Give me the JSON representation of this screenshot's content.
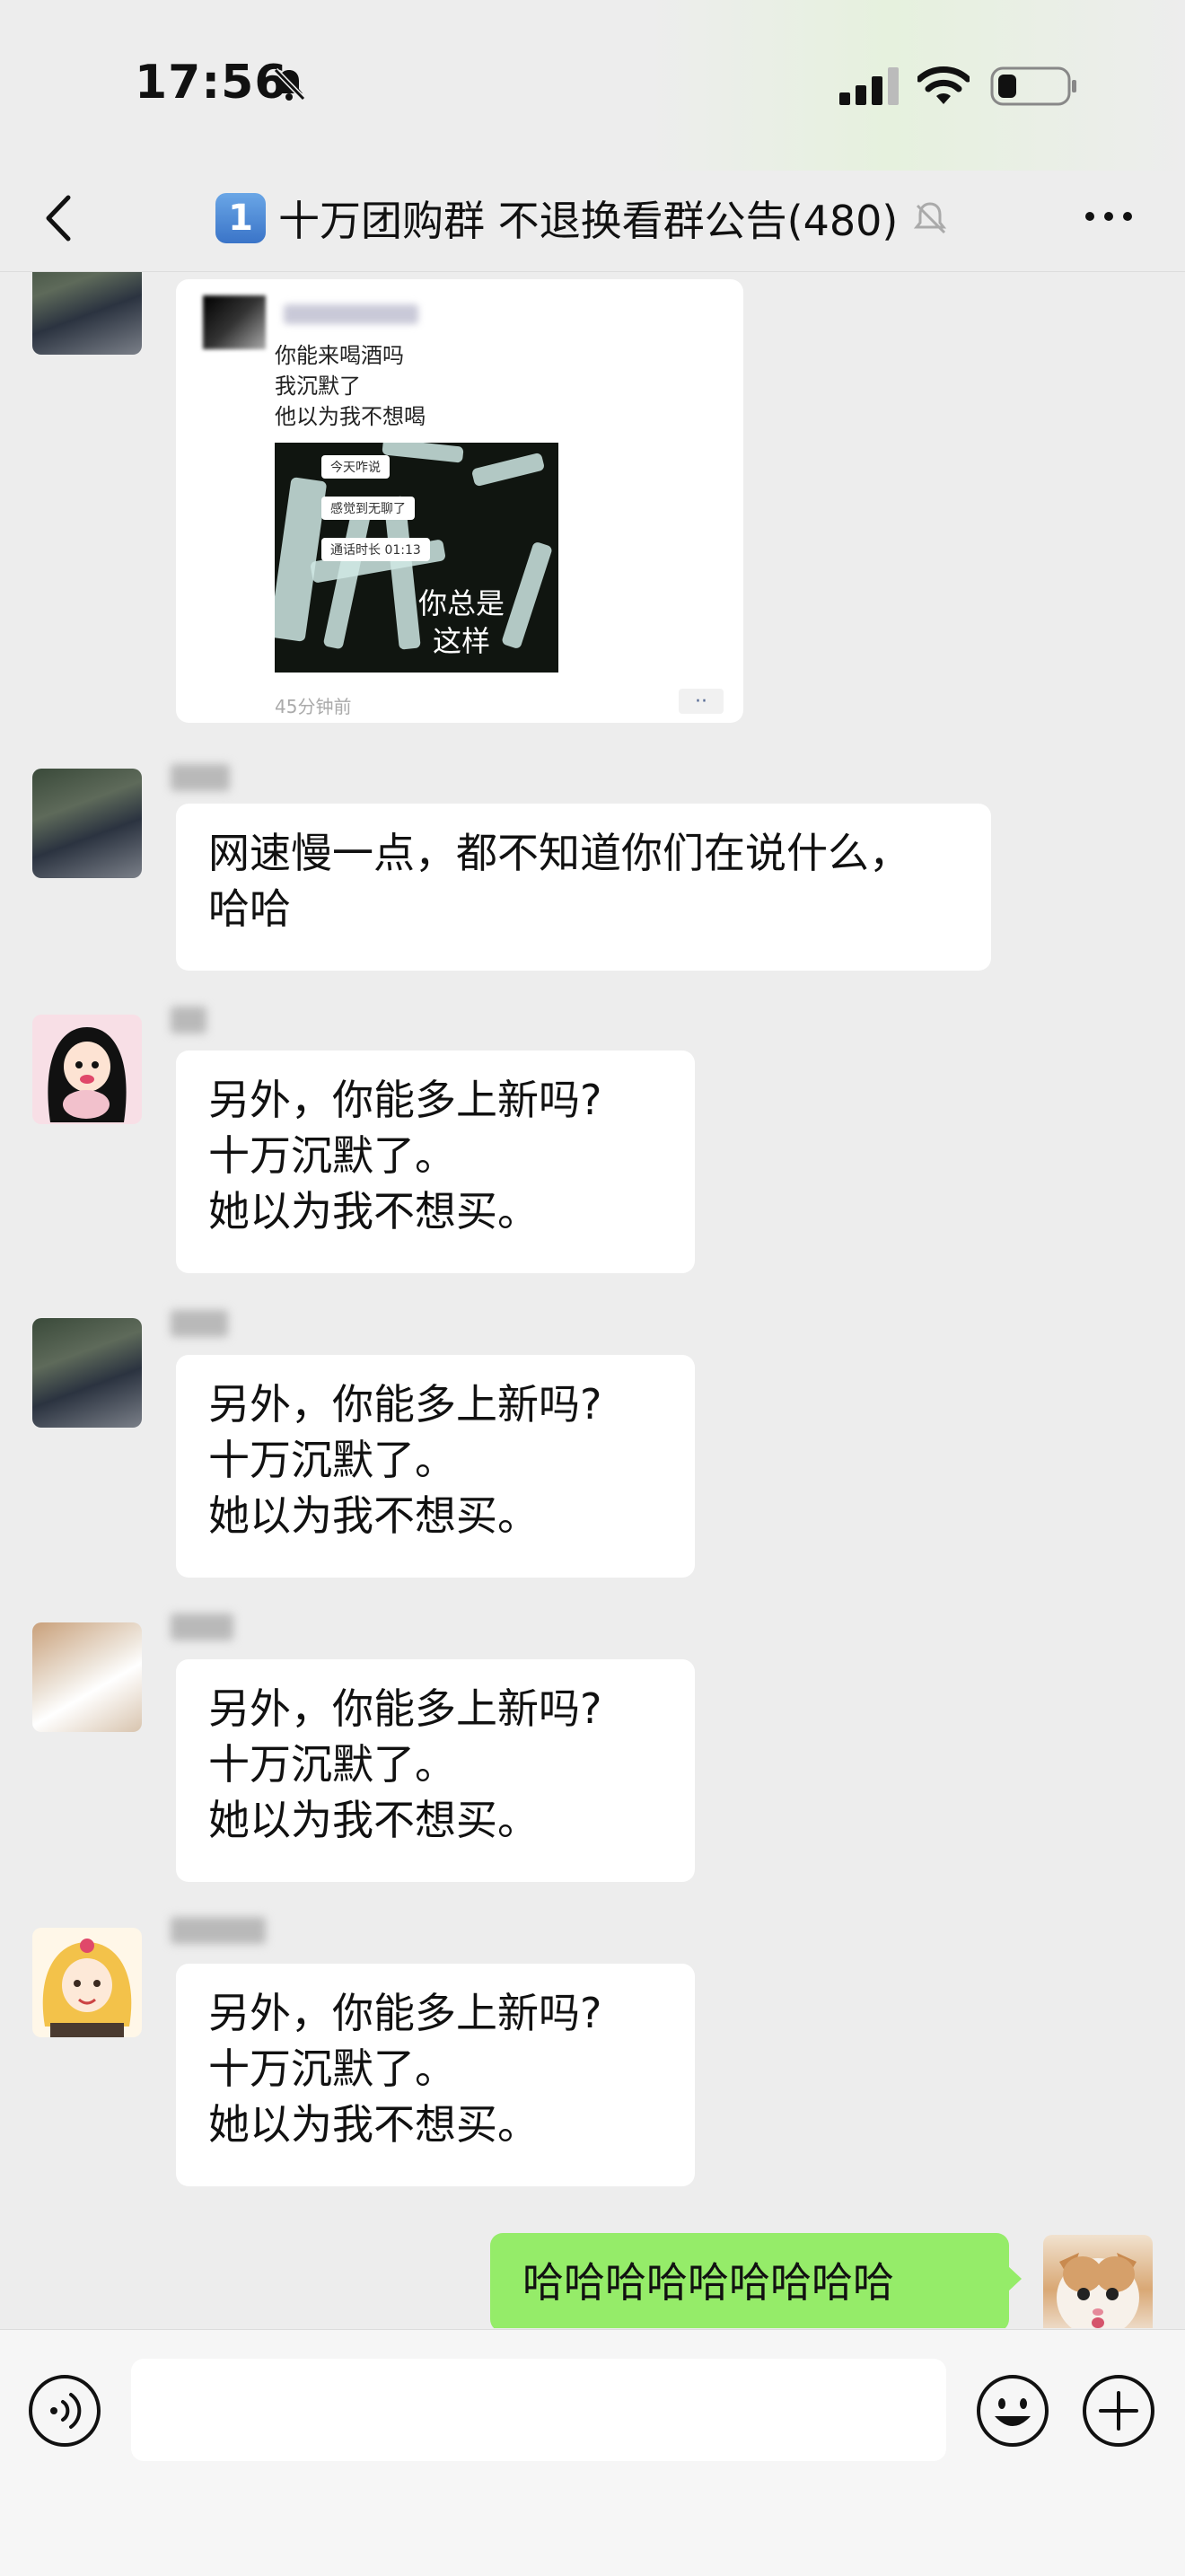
{
  "status_bar": {
    "time": "17:56"
  },
  "nav": {
    "badge": "1",
    "title": "十万团购群 不退换看群公告(480)"
  },
  "moment_card": {
    "lines": "你能来喝酒吗\n我沉默了\n他以为我不想喝",
    "image_chips": [
      "今天咋说",
      "感觉到无聊了",
      "通话时长 01:13"
    ],
    "image_caption": "你总是\n这样",
    "time": "45分钟前",
    "more": "··"
  },
  "messages": [
    {
      "text": "网速慢一点，都不知道你们在说什么，\n哈哈"
    },
    {
      "text": "另外，你能多上新吗?\n十万沉默了。\n她以为我不想买。"
    },
    {
      "text": "另外，你能多上新吗?\n十万沉默了。\n她以为我不想买。"
    },
    {
      "text": "另外，你能多上新吗?\n十万沉默了。\n她以为我不想买。"
    },
    {
      "text": "另外，你能多上新吗?\n十万沉默了。\n她以为我不想买。"
    },
    {
      "text": "哈哈哈哈哈哈哈哈哈"
    }
  ],
  "colors": {
    "background": "#ededed",
    "sent_bubble": "#95ec69",
    "received_bubble": "#ffffff"
  },
  "icons": {
    "status": [
      "bell-slash-icon",
      "cellular-signal-icon",
      "wifi-icon",
      "battery-icon"
    ],
    "nav": [
      "back-chevron-icon",
      "muted-bell-icon",
      "more-dots-icon"
    ],
    "input": [
      "voice-icon",
      "emoji-icon",
      "plus-icon"
    ]
  }
}
